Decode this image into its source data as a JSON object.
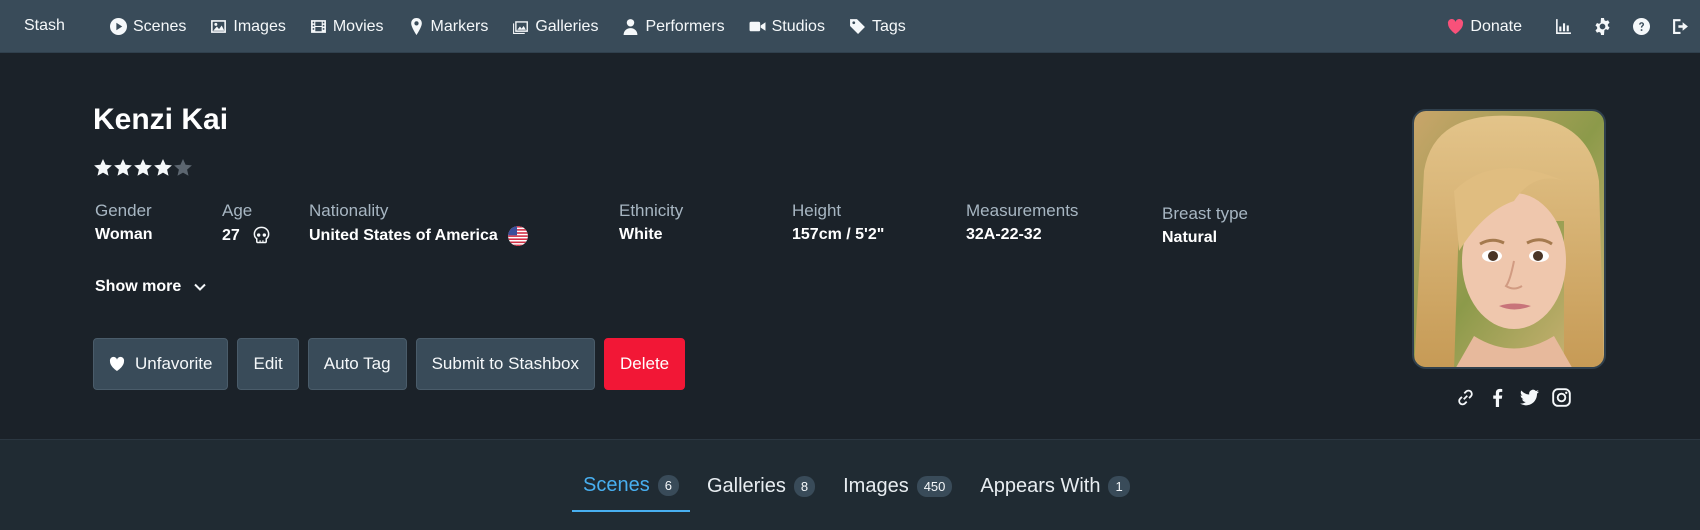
{
  "nav": {
    "brand": "Stash",
    "links": [
      {
        "label": "Scenes",
        "icon": "play-circle-icon"
      },
      {
        "label": "Images",
        "icon": "image-icon"
      },
      {
        "label": "Movies",
        "icon": "film-icon"
      },
      {
        "label": "Markers",
        "icon": "map-marker-icon"
      },
      {
        "label": "Galleries",
        "icon": "images-icon"
      },
      {
        "label": "Performers",
        "icon": "user-icon"
      },
      {
        "label": "Studios",
        "icon": "video-icon"
      },
      {
        "label": "Tags",
        "icon": "tag-icon"
      }
    ],
    "donate_label": "Donate",
    "right_icons": [
      "chart-icon",
      "gear-icon",
      "help-icon",
      "sign-out-icon"
    ]
  },
  "performer": {
    "name": "Kenzi Kai",
    "rating": 4,
    "rating_max": 5,
    "details": {
      "gender_label": "Gender",
      "gender": "Woman",
      "age_label": "Age",
      "age": "27",
      "nationality_label": "Nationality",
      "nationality": "United States of America",
      "ethnicity_label": "Ethnicity",
      "ethnicity": "White",
      "height_label": "Height",
      "height": "157cm / 5'2\"",
      "measurements_label": "Measurements",
      "measurements": "32A-22-32",
      "breast_label": "Breast type",
      "breast": "Natural"
    },
    "show_more": "Show more"
  },
  "actions": {
    "unfavorite": "Unfavorite",
    "edit": "Edit",
    "autotag": "Auto Tag",
    "submit": "Submit to Stashbox",
    "delete": "Delete"
  },
  "social_icons": [
    "link-icon",
    "facebook-icon",
    "twitter-icon",
    "instagram-icon"
  ],
  "tabs": [
    {
      "label": "Scenes",
      "count": "6",
      "active": true
    },
    {
      "label": "Galleries",
      "count": "8",
      "active": false
    },
    {
      "label": "Images",
      "count": "450",
      "active": false
    },
    {
      "label": "Appears With",
      "count": "1",
      "active": false
    }
  ],
  "colors": {
    "nav_bg": "#394b59",
    "page_bg": "#1b2229",
    "accent": "#48aff0",
    "delete": "#f21736",
    "heart": "#f8517a"
  }
}
